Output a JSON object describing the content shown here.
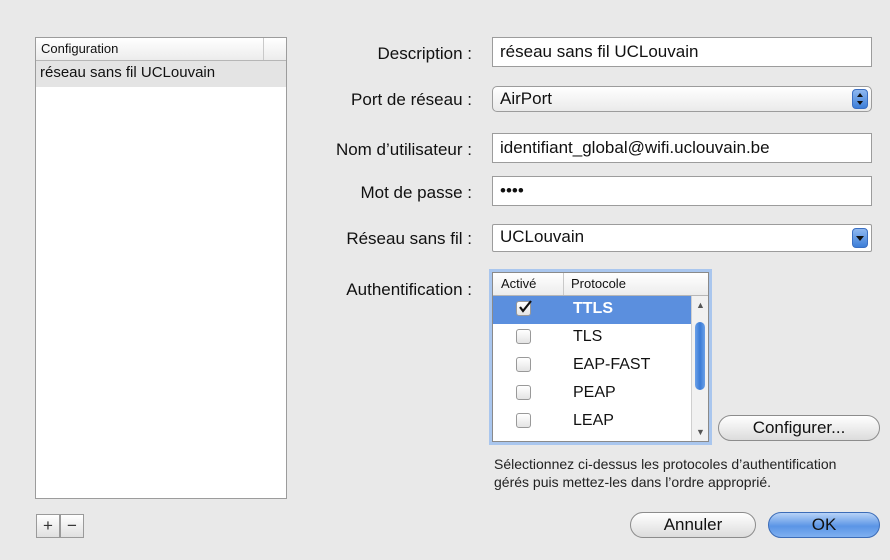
{
  "list": {
    "header": "Configuration",
    "items": [
      "réseau sans fil UCLouvain"
    ],
    "add_label": "+",
    "remove_label": "−"
  },
  "form": {
    "description_label": "Description :",
    "description_value": "réseau sans fil UCLouvain",
    "port_label": "Port de réseau :",
    "port_value": "AirPort",
    "user_label": "Nom d’utilisateur :",
    "user_value": "identifiant_global@wifi.uclouvain.be",
    "password_label": "Mot de passe :",
    "password_value": "••••",
    "network_label": "Réseau sans fil :",
    "network_value": "UCLouvain",
    "auth_label": "Authentification :"
  },
  "auth": {
    "col_active": "Activé",
    "col_protocol": "Protocole",
    "rows": [
      {
        "name": "TTLS",
        "checked": true,
        "selected": true
      },
      {
        "name": "TLS",
        "checked": false,
        "selected": false
      },
      {
        "name": "EAP-FAST",
        "checked": false,
        "selected": false
      },
      {
        "name": "PEAP",
        "checked": false,
        "selected": false
      },
      {
        "name": "LEAP",
        "checked": false,
        "selected": false
      }
    ]
  },
  "buttons": {
    "configure": "Configurer...",
    "cancel": "Annuler",
    "ok": "OK"
  },
  "help_text": "Sélectionnez ci-dessus les protocoles d’authentification gérés puis mettez-les dans l’ordre approprié."
}
